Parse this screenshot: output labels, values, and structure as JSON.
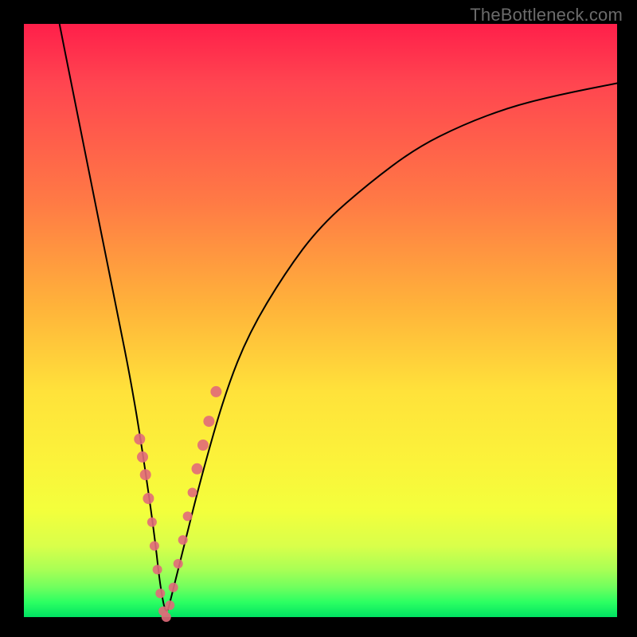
{
  "watermark": "TheBottleneck.com",
  "colors": {
    "frame": "#000000",
    "gradient_top": "#ff1f4a",
    "gradient_mid": "#ffe23a",
    "gradient_bottom": "#00e262",
    "curve": "#000000",
    "marker": "#e16a7a"
  },
  "chart_data": {
    "type": "line",
    "title": "",
    "xlabel": "",
    "ylabel": "",
    "xlim": [
      0,
      100
    ],
    "ylim": [
      0,
      100
    ],
    "series": [
      {
        "name": "bottleneck-curve",
        "x": [
          6,
          8,
          10,
          12,
          14,
          16,
          18,
          20,
          22,
          23,
          24,
          25,
          27,
          30,
          34,
          38,
          44,
          50,
          58,
          66,
          74,
          82,
          90,
          100
        ],
        "y": [
          100,
          90,
          80,
          70,
          60,
          50,
          40,
          28,
          14,
          5,
          0,
          4,
          12,
          24,
          38,
          48,
          58,
          66,
          73,
          79,
          83,
          86,
          88,
          90
        ]
      }
    ],
    "markers": {
      "name": "highlight-points",
      "x": [
        19.5,
        20.0,
        20.5,
        21.0,
        21.6,
        22.0,
        22.5,
        23.0,
        23.5,
        24.0,
        24.6,
        25.2,
        26.0,
        26.8,
        27.6,
        28.4,
        29.2,
        30.2,
        31.2,
        32.4
      ],
      "y": [
        30,
        27,
        24,
        20,
        16,
        12,
        8,
        4,
        1,
        0,
        2,
        5,
        9,
        13,
        17,
        21,
        25,
        29,
        33,
        38
      ],
      "r": [
        7,
        7,
        7,
        7,
        6,
        6,
        6,
        6,
        6,
        6,
        6,
        6,
        6,
        6,
        6,
        6,
        7,
        7,
        7,
        7
      ]
    }
  }
}
